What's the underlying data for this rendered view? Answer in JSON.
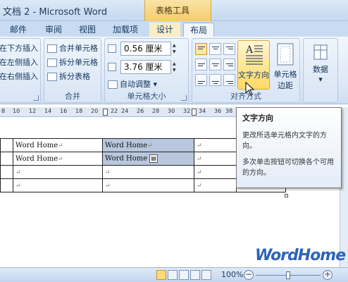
{
  "window": {
    "title": "文档 2 - Microsoft Word",
    "context_tab_title": "表格工具"
  },
  "tabs": [
    {
      "label": "邮件"
    },
    {
      "label": "审阅"
    },
    {
      "label": "视图"
    },
    {
      "label": "加载项"
    },
    {
      "label": "设计"
    },
    {
      "label": "布局"
    }
  ],
  "ribbon": {
    "rows_group": {
      "items": [
        "在下方插入",
        "在左侧插入",
        "在右侧插入"
      ]
    },
    "merge_group": {
      "label": "合并",
      "items": [
        "合并单元格",
        "拆分单元格",
        "拆分表格"
      ]
    },
    "cell_size_group": {
      "label": "单元格大小",
      "height_value": "0.56 厘米",
      "width_value": "3.76 厘米",
      "autofit_label": "自动调整"
    },
    "alignment_group": {
      "label": "对齐方式",
      "text_direction_label": "文字方向",
      "cell_margins_label_1": "单元格",
      "cell_margins_label_2": "边距"
    },
    "data_group": {
      "label": "数据"
    }
  },
  "ruler": {
    "ticks": [
      "8",
      "10",
      "12",
      "14",
      "16",
      "18",
      "20",
      "22",
      "24",
      "26",
      "28",
      "30",
      "32",
      "34",
      "36",
      "38"
    ]
  },
  "table": {
    "rows": [
      [
        "",
        "Word Home",
        "",
        "Word Home",
        "",
        "",
        ""
      ],
      [
        "",
        "Word Home",
        "",
        "Word Home",
        "",
        "",
        ""
      ],
      [
        "",
        "",
        "",
        "",
        "",
        "",
        ""
      ],
      [
        "",
        "",
        "",
        "",
        "",
        "",
        ""
      ]
    ],
    "cell_mark": "↵"
  },
  "tooltip": {
    "title": "文字方向",
    "body1": "更改所选单元格内文字的方向。",
    "body2": "多次单击按钮可切换各个可用的方向。"
  },
  "watermark": "WordHome",
  "statusbar": {
    "zoom": "100%"
  },
  "colors": {
    "accent": "#2d64b8",
    "context_tab": "#f3cd6b",
    "selection": "#b8c7de"
  }
}
